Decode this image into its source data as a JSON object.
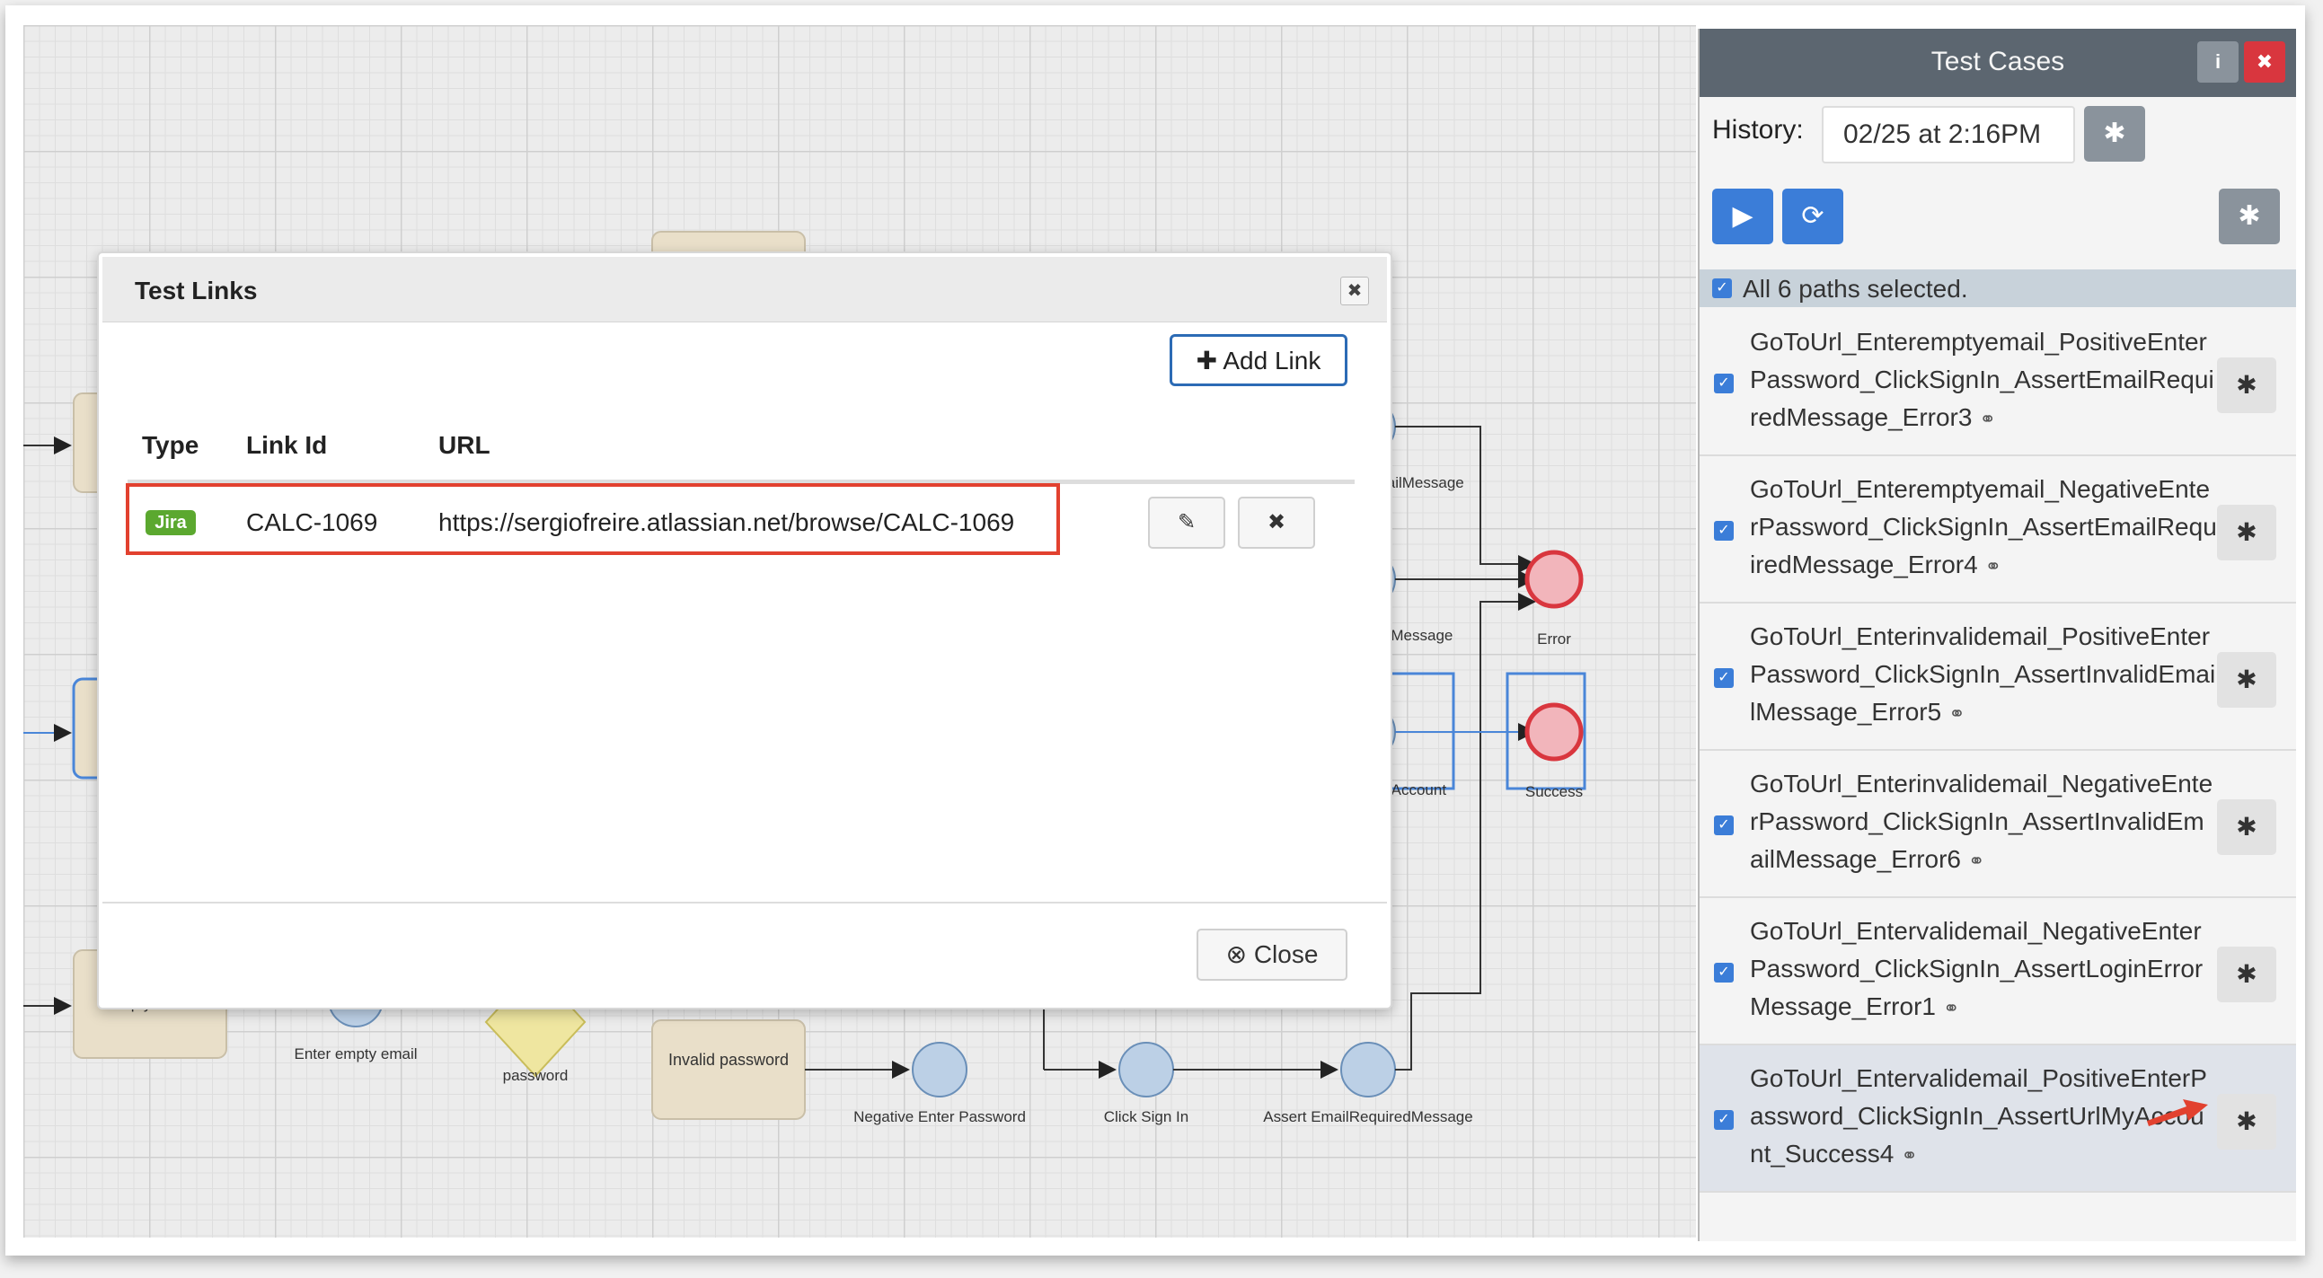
{
  "diagram": {
    "nodes": [
      {
        "label": "EmailMessage"
      },
      {
        "label": "ErrorMessage"
      },
      {
        "label": "MyAccount"
      },
      {
        "label": "Error"
      },
      {
        "label": "Success"
      },
      {
        "label": "Empty email"
      },
      {
        "label": "Enter empty email"
      },
      {
        "label": "password"
      },
      {
        "label": "Invalid password"
      },
      {
        "label": "Negative Enter Password"
      },
      {
        "label": "Click Sign In"
      },
      {
        "label": "Assert EmailRequiredMessage"
      }
    ]
  },
  "modal": {
    "title": "Test Links",
    "close_x": "✖",
    "add_link": "Add Link",
    "add_link_icon": "✚",
    "columns": {
      "type": "Type",
      "link_id": "Link Id",
      "url": "URL"
    },
    "rows": [
      {
        "type": "Jira",
        "link_id": "CALC-1069",
        "url": "https://sergiofreire.atlassian.net/browse/CALC-1069"
      }
    ],
    "edit_icon": "✎",
    "delete_icon": "✖",
    "close_label": "Close",
    "close_icon": "⊗",
    "highlight_color": "#e2412f"
  },
  "panel": {
    "title": "Test Cases",
    "info": "i",
    "close": "✖",
    "history_label": "History:",
    "history_value": "02/25 at 2:16PM",
    "gear": "✱",
    "play": "▶",
    "refresh": "⟳",
    "select_all": "All 6 paths selected.",
    "paths": [
      {
        "name": "GoToUrl_Enteremptyemail_PositiveEnterPassword_ClickSignIn_AssertEmailRequiredMessage_Error3"
      },
      {
        "name": "GoToUrl_Enteremptyemail_NegativeEnterPassword_ClickSignIn_AssertEmailRequiredMessage_Error4"
      },
      {
        "name": "GoToUrl_Enterinvalidemail_PositiveEnterPassword_ClickSignIn_AssertInvalidEmailMessage_Error5"
      },
      {
        "name": "GoToUrl_Enterinvalidemail_NegativeEnterPassword_ClickSignIn_AssertInvalidEmailMessage_Error6"
      },
      {
        "name": "GoToUrl_Entervalidemail_NegativeEnterPassword_ClickSignIn_AssertLoginErrorMessage_Error1"
      },
      {
        "name": "GoToUrl_Entervalidemail_PositiveEnterPassword_ClickSignIn_AssertUrlMyAccount_Success4"
      }
    ],
    "link_symbol": "⚭",
    "accent_color": "#3b7dd8"
  }
}
